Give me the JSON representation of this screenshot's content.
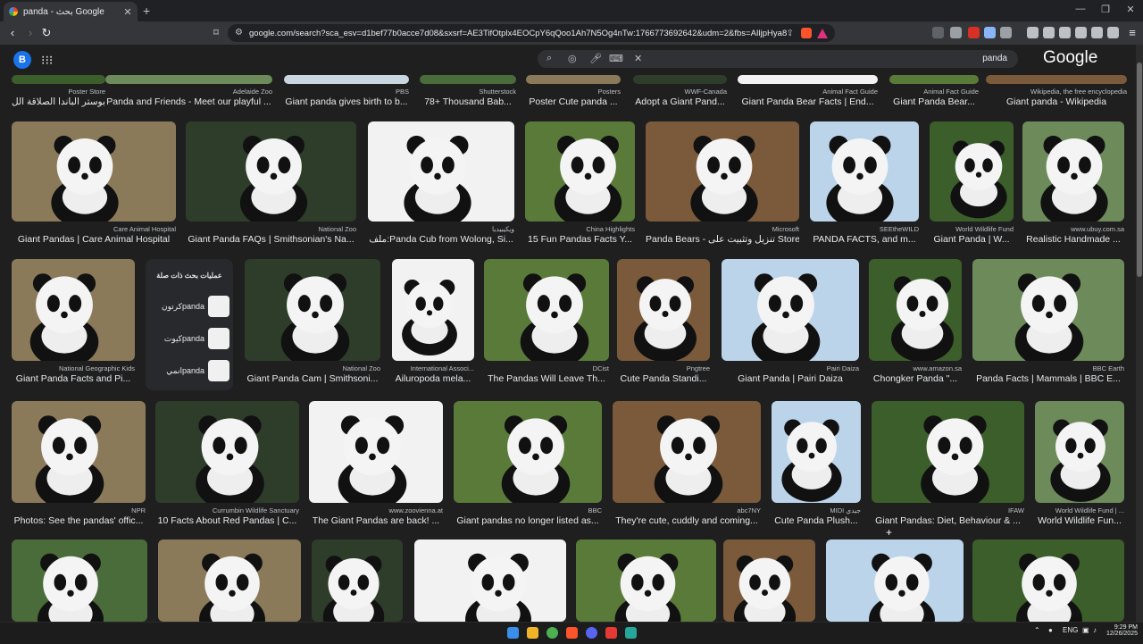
{
  "browser": {
    "tab_title": "panda - بحث Google",
    "url": "google.com/search?sca_esv=d1bef77b0acce7d08&sxsrf=AE3TifOtplx4EOCpY6qQoo1Ah7N5Og4nTw:1766773692642&udm=2&fbs=AIljpHya8RJaG7G..."
  },
  "google": {
    "avatar_letter": "B",
    "query": "panda",
    "logo": "Google"
  },
  "row0": [
    {
      "source": "Poster Store",
      "caption": "بوستر الباندا الصلاقة الل..."
    },
    {
      "source": "Adelaide Zoo",
      "caption": "Panda and Friends - Meet our playful ..."
    },
    {
      "source": "PBS",
      "caption": "Giant panda gives birth to b..."
    },
    {
      "source": "Shutterstock",
      "caption": "78+ Thousand Bab..."
    },
    {
      "source": "Posters",
      "caption": "Poster Cute panda ..."
    },
    {
      "source": "WWF-Canada",
      "caption": "Adopt a Giant Pand..."
    },
    {
      "source": "Animal Fact Guide",
      "caption": "Giant Panda Bear Facts | End..."
    },
    {
      "source": "Animal Fact Guide",
      "caption": "Giant Panda Bear..."
    },
    {
      "source": "Wikipedia, the free encyclopedia",
      "caption": "Giant panda - Wikipedia"
    }
  ],
  "row1": [
    {
      "source": "Care Animal Hospital",
      "caption": "Giant Pandas | Care Animal Hospital"
    },
    {
      "source": "National Zoo",
      "caption": "Giant Panda FAQs | Smithsonian's Na..."
    },
    {
      "source": "ويكيبيديا",
      "caption": "ملف:Panda Cub from Wolong, Si..."
    },
    {
      "source": "China Highlights",
      "caption": "15 Fun Pandas Facts Y..."
    },
    {
      "source": "Microsoft",
      "caption": "Panda Bears - تنزيل وتثبيت على Store ..."
    },
    {
      "source": "SEEtheWILD",
      "caption": "PANDA FACTS, and m..."
    },
    {
      "source": "World Wildlife Fund",
      "caption": "Giant Panda | W..."
    },
    {
      "source": "www.ubuy.com.sa",
      "caption": "Realistic Handmade ..."
    }
  ],
  "related": {
    "heading": "عمليات بحث ذات صلة",
    "items": [
      "كرتونpanda",
      "كيوتpanda",
      "انميpanda"
    ]
  },
  "row2": [
    {
      "source": "National Geographic Kids",
      "caption": "Giant Panda Facts and Pi..."
    },
    {
      "source": "National Zoo",
      "caption": "Giant Panda Cam | Smithsoni..."
    },
    {
      "source": "International Associ...",
      "caption": "Ailuropoda mela..."
    },
    {
      "source": "DCist",
      "caption": "The Pandas Will Leave Th..."
    },
    {
      "source": "Pngtree",
      "caption": "Cute Panda Standi..."
    },
    {
      "source": "Pairi Daiza",
      "caption": "Giant Panda | Pairi Daiza"
    },
    {
      "source": "www.amazon.sa",
      "caption": "Chongker Panda \"..."
    },
    {
      "source": "BBC Earth",
      "caption": "Panda Facts | Mammals | BBC E..."
    }
  ],
  "row3": [
    {
      "source": "NPR",
      "caption": "Photos: See the pandas' offic..."
    },
    {
      "source": "Currumbin Wildlife Sanctuary",
      "caption": "10 Facts About Red Pandas | C..."
    },
    {
      "source": "www.zoovienna.at",
      "caption": "The Giant Pandas are back! ..."
    },
    {
      "source": "BBC",
      "caption": "Giant pandas no longer listed as..."
    },
    {
      "source": "abc7NY",
      "caption": "They're cute, cuddly and coming..."
    },
    {
      "source": "MIDI جيدي",
      "caption": "Cute Panda Plush..."
    },
    {
      "source": "IFAW",
      "caption": "Giant Pandas: Diet, Behaviour & ..."
    },
    {
      "source": "World Wildlife Fund | ...",
      "caption": "World Wildlife Fun..."
    }
  ],
  "taskbar": {
    "lang": "ENG",
    "time": "9:29 PM",
    "date": "12/26/2025"
  },
  "colors": {
    "background": "#1f1f1f",
    "card_text": "#e8eaed",
    "source_text": "#bdc1c6",
    "accent_blue": "#1a73e8"
  }
}
